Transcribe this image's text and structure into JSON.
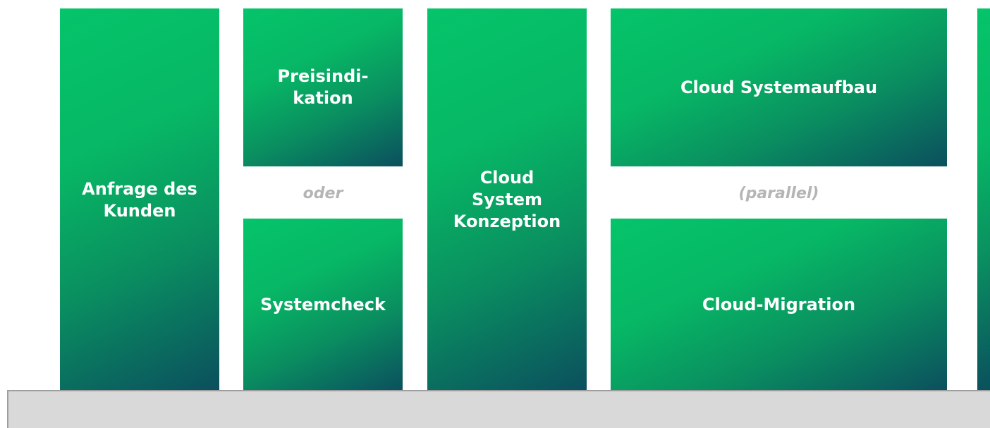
{
  "process": {
    "anfrage": "Anfrage des\nKunden",
    "preisindikation": "Preisindi-\nkation",
    "oder": "oder",
    "systemcheck": "Systemcheck",
    "konzeption": "Cloud\nSystem\nKonzeption",
    "systemaufbau": "Cloud Systemaufbau",
    "parallel": "(parallel)",
    "migration": "Cloud-Migration"
  },
  "colors": {
    "gradient_start": "#05c46a",
    "gradient_end": "#0b4f5e",
    "connector_text": "#b5b5b5",
    "footer_bar": "#d9d9d9"
  }
}
